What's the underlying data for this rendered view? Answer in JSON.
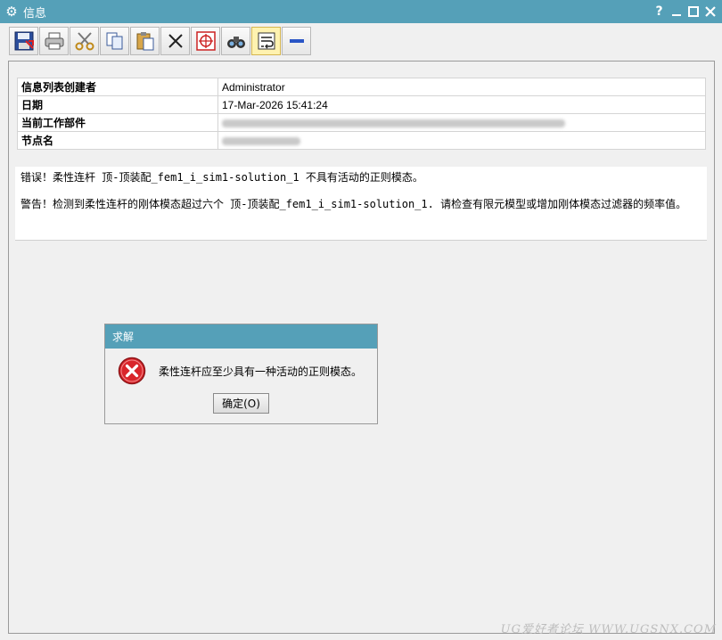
{
  "window": {
    "title": "信息",
    "icon": "gear-icon",
    "controls": {
      "help": "?",
      "minimize": "–",
      "maximize": "□",
      "close": "✕"
    }
  },
  "toolbar": {
    "buttons": [
      {
        "name": "save-icon"
      },
      {
        "name": "print-icon"
      },
      {
        "name": "cut-icon"
      },
      {
        "name": "copy-icon"
      },
      {
        "name": "paste-icon"
      },
      {
        "name": "delete-icon"
      },
      {
        "name": "target-icon"
      },
      {
        "name": "binoculars-icon"
      },
      {
        "name": "wrap-text-icon",
        "active": true
      },
      {
        "name": "minus-icon"
      }
    ]
  },
  "info": {
    "rows": [
      {
        "key": "信息列表创建者",
        "value": "Administrator"
      },
      {
        "key": "日期",
        "value": "17-Mar-2026 15:41:24"
      },
      {
        "key": "当前工作部件",
        "value": ""
      },
      {
        "key": "节点名",
        "value": ""
      }
    ]
  },
  "messages": {
    "error": "错误！柔性连杆 顶-顶装配_fem1_i_sim1-solution_1 不具有活动的正则模态。",
    "warning": "警告！检测到柔性连杆的刚体模态超过六个 顶-顶装配_fem1_i_sim1-solution_1. 请检查有限元模型或增加刚体模态过滤器的频率值。"
  },
  "dialog": {
    "title": "求解",
    "message": "柔性连杆应至少具有一种活动的正则模态。",
    "ok_label": "确定(O)"
  },
  "watermark": "UG爱好者论坛 WWW.UGSNX.COM",
  "colors": {
    "titlebar": "#55a0b8",
    "error": "#d9262b"
  }
}
